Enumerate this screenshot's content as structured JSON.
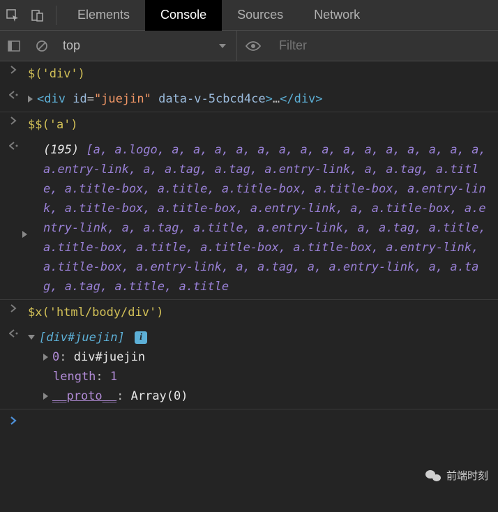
{
  "tabs": {
    "t0": "Elements",
    "t1": "Console",
    "t2": "Sources",
    "t3": "Network"
  },
  "toolbar": {
    "context": "top",
    "filter_placeholder": "Filter"
  },
  "entries": {
    "e1_input": "$('div')",
    "e1_tag_open": "<div",
    "e1_attr1_name": "id",
    "e1_attr1_val": "\"juejin\"",
    "e1_attr2_name": "data-v-5cbcd4ce",
    "e1_mid": ">",
    "e1_ellipsis": "…",
    "e1_close": "</div>",
    "e2_input": "$$('a')",
    "e2_count": "(195)",
    "e2_array": "[a, a.logo, a, a, a, a, a, a, a, a, a, a, a, a, a, a, a, a.entry-link, a, a.tag, a.tag, a.entry-link, a, a.tag, a.title, a.title-box, a.title, a.title-box, a.title-box, a.entry-link, a.title-box, a.title-box, a.entry-link, a, a.title-box, a.entry-link, a, a.tag, a.title, a.entry-link, a, a.tag, a.title, a.title-box, a.title, a.title-box, a.title-box, a.entry-link, a.title-box, a.entry-link, a, a.tag, a, a.entry-link, a, a.tag, a.tag, a.title, a.title",
    "e3_input": "$x('html/body/div')",
    "e3_header": "[div#juejin]",
    "e3_k0": "0",
    "e3_v0": "div#juejin",
    "e3_len_k": "length",
    "e3_len_v": "1",
    "e3_proto_k": "__proto__",
    "e3_proto_v": "Array(0)"
  },
  "watermark": "前端时刻"
}
